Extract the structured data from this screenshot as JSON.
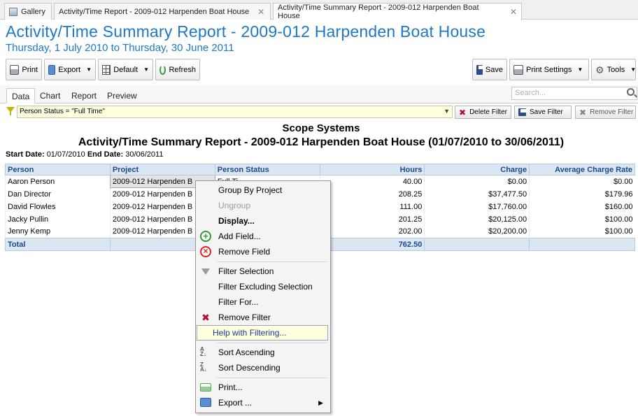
{
  "tabs": [
    {
      "label": "Gallery",
      "active": false
    },
    {
      "label": "Activity/Time Report - 2009-012 Harpenden Boat House",
      "active": false
    },
    {
      "label": "Activity/Time Summary Report - 2009-012 Harpenden Boat House",
      "active": true
    }
  ],
  "header": {
    "title": "Activity/Time Summary Report - 2009-012 Harpenden Boat House",
    "subtitle": "Thursday, 1 July 2010 to Thursday, 30 June 2011"
  },
  "toolbar": {
    "print": "Print",
    "export": "Export",
    "default": "Default",
    "refresh": "Refresh",
    "save": "Save",
    "print_settings": "Print Settings",
    "tools": "Tools"
  },
  "view_tabs": [
    "Data",
    "Chart",
    "Report",
    "Preview"
  ],
  "search": {
    "placeholder": "Search..."
  },
  "filter": {
    "expression": "Person Status = \"Full Time\"",
    "delete": "Delete Filter",
    "save": "Save Filter",
    "remove": "Remove Filter"
  },
  "report": {
    "company": "Scope Systems",
    "title": "Activity/Time Summary Report - 2009-012 Harpenden Boat House (01/07/2010 to 30/06/2011)",
    "start_label": "Start Date:",
    "start_value": "01/07/2010",
    "end_label": "End Date:",
    "end_value": "30/06/2011"
  },
  "table": {
    "columns": [
      "Person",
      "Project",
      "Person Status",
      "Hours",
      "Charge",
      "Average Charge Rate"
    ],
    "rows": [
      [
        "Aaron Person",
        "2009-012 Harpenden B",
        "Full Ti",
        "40.00",
        "$0.00",
        "$0.00"
      ],
      [
        "Dan Director",
        "2009-012 Harpenden B",
        "",
        "208.25",
        "$37,477.50",
        "$179.96"
      ],
      [
        "David Flowles",
        "2009-012 Harpenden B",
        "",
        "111.00",
        "$17,760.00",
        "$160.00"
      ],
      [
        "Jacky Pullin",
        "2009-012 Harpenden B",
        "",
        "201.25",
        "$20,125.00",
        "$100.00"
      ],
      [
        "Jenny Kemp",
        "2009-012 Harpenden B",
        "",
        "202.00",
        "$20,200.00",
        "$100.00"
      ]
    ],
    "total": {
      "label": "Total",
      "hours": "762.50"
    }
  },
  "context_menu": {
    "group_by_project": "Group By Project",
    "ungroup": "Ungroup",
    "display": "Display...",
    "add_field": "Add Field...",
    "remove_field": "Remove Field",
    "filter_selection": "Filter Selection",
    "filter_excluding": "Filter Excluding Selection",
    "filter_for": "Filter For...",
    "remove_filter": "Remove Filter",
    "help_filtering": "Help with Filtering...",
    "sort_ascending": "Sort Ascending",
    "sort_descending": "Sort Descending",
    "print": "Print...",
    "export": "Export ..."
  }
}
